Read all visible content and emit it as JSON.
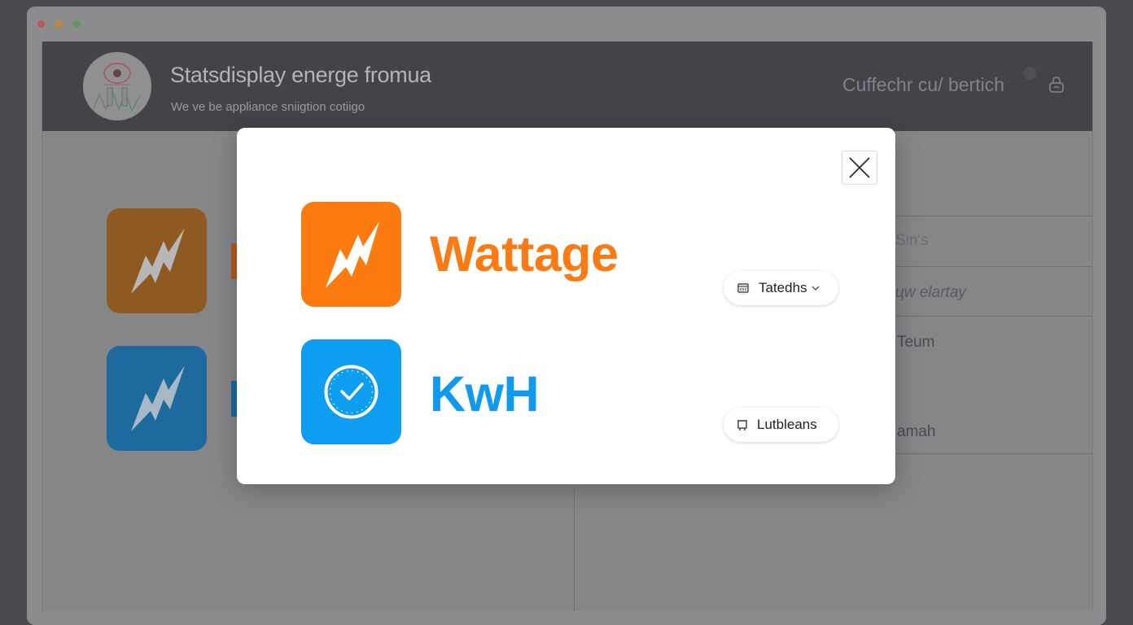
{
  "window": {
    "traffic_lights": [
      "close",
      "minimize",
      "zoom"
    ]
  },
  "header": {
    "title": "Statsdisplay energe fromua",
    "subtitle": "We ve be appliance sniigtion cotiigo",
    "link": "Cuffechr cu/ bertich"
  },
  "right_panel": {
    "items": [
      "Sin's",
      "цw elartay",
      "Teum",
      "amah"
    ]
  },
  "modal": {
    "close_icon": "close-icon",
    "items": [
      {
        "label": "Wattage",
        "icon": "bolt-icon",
        "color": "#fb7b11",
        "action": "Tatedhs",
        "action_icon": "calendar-icon"
      },
      {
        "label": "KwH",
        "icon": "clock-icon",
        "color": "#0d9ef2",
        "action": "Lutbleans",
        "action_icon": "clip-icon"
      }
    ]
  },
  "colors": {
    "orange": "#fb7b11",
    "blue": "#0d9ef2",
    "header_bg": "#434349"
  }
}
